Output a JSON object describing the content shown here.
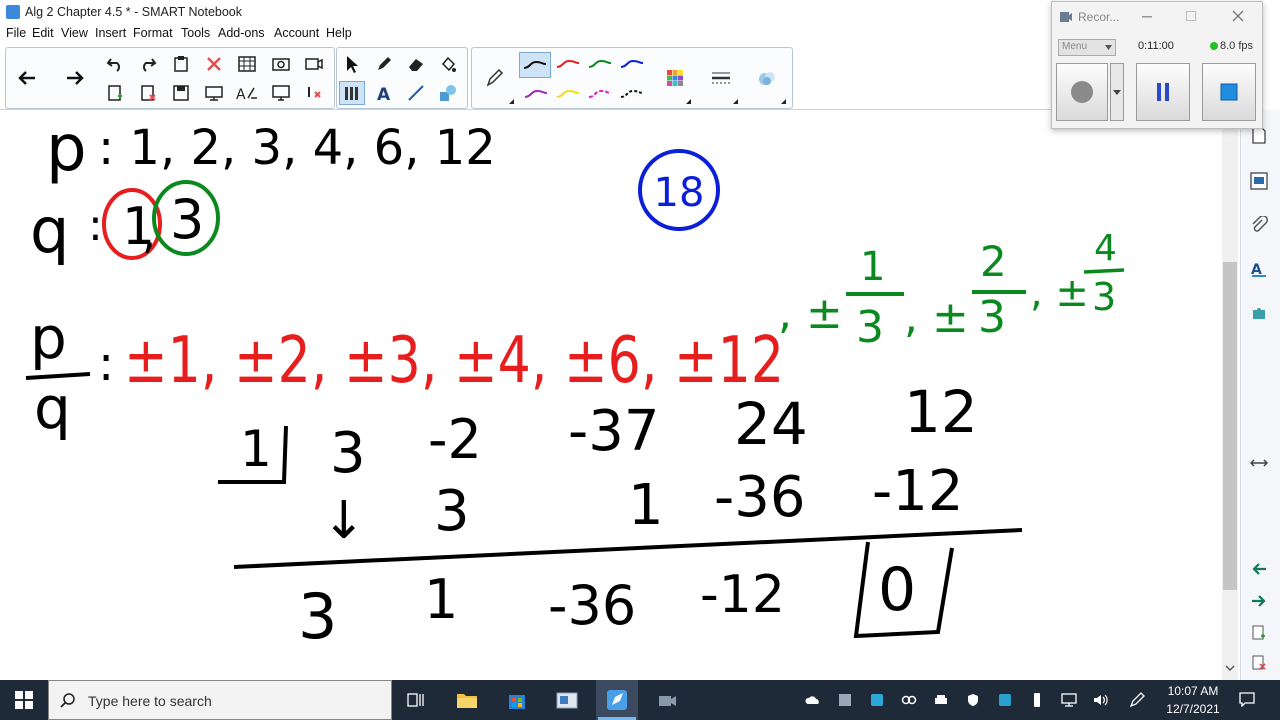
{
  "window": {
    "title": "Alg 2 Chapter 4.5 * - SMART Notebook"
  },
  "menu": [
    "File",
    "Edit",
    "View",
    "Insert",
    "Format",
    "Tools",
    "Add-ons",
    "Account",
    "Help"
  ],
  "colors": {
    "red": "#e61e1e",
    "green": "#0a8a1e",
    "blue": "#0b1fd8",
    "black": "#000000",
    "taskbar": "#1f2a38"
  },
  "recorder": {
    "title": "Recor...",
    "menu_label": "Menu",
    "time": "0:11:00",
    "fps": "8.0 fps"
  },
  "notes": {
    "p_label": "p",
    "p_list": ": 1, 2, 3, 4, 6, 12",
    "q_label": "q",
    "q_colon": ":",
    "q_one": "1",
    "q_comma": ",",
    "q_three": "3",
    "circle_value": "18",
    "pq_num": "p",
    "pq_den": "q",
    "pq_colon": ":",
    "red_list": "±1, ±2, ±3, ±4, ±6, ±12",
    "green_pm1": ", ±",
    "green_num1": "1",
    "green_den1": "3",
    "green_pm2": ", ±",
    "green_num2": "2",
    "green_den2": "3",
    "green_pm3": ", ±",
    "green_num3": "4",
    "green_den3": "3",
    "synthetic": {
      "divisor": "1",
      "coefficients": [
        "3",
        "-2",
        "-37",
        "24",
        "12"
      ],
      "arrow": "↓",
      "middle": [
        "3",
        "1",
        "-36",
        "-12"
      ],
      "result": [
        "3",
        "1",
        "-36",
        "-12"
      ],
      "remainder": "0"
    }
  },
  "taskbar": {
    "search_placeholder": "Type here to search",
    "time": "10:07 AM",
    "date": "12/7/2021"
  }
}
